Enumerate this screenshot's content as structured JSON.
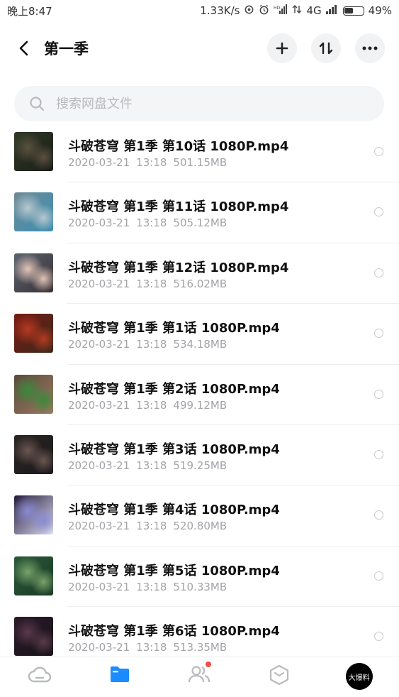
{
  "status_bar": {
    "time": "晚上8:47",
    "speed": "1.33K/s",
    "network": "4G",
    "battery": "49%",
    "battery_level": 0.49
  },
  "header": {
    "title": "第一季"
  },
  "search": {
    "placeholder": "搜索网盘文件"
  },
  "files": [
    {
      "name": "斗破苍穹 第1季 第10话 1080P.mp4",
      "date": "2020-03-21",
      "time": "13:18",
      "size": "501.15MB",
      "thumb_colors": [
        "#2e3a25",
        "#5a5040",
        "#1c1c18"
      ]
    },
    {
      "name": "斗破苍穹 第1季 第11话 1080P.mp4",
      "date": "2020-03-21",
      "time": "13:18",
      "size": "505.12MB",
      "thumb_colors": [
        "#6e8a96",
        "#b7c8cf",
        "#3c8fb2"
      ]
    },
    {
      "name": "斗破苍穹 第1季 第12话 1080P.mp4",
      "date": "2020-03-21",
      "time": "13:18",
      "size": "516.02MB",
      "thumb_colors": [
        "#5a6470",
        "#e2c4b6",
        "#3a3036"
      ]
    },
    {
      "name": "斗破苍穹 第1季 第1话 1080P.mp4",
      "date": "2020-03-21",
      "time": "13:18",
      "size": "534.18MB",
      "thumb_colors": [
        "#7a1a14",
        "#b53a22",
        "#3a2a1a"
      ]
    },
    {
      "name": "斗破苍穹 第1季 第2话 1080P.mp4",
      "date": "2020-03-21",
      "time": "13:18",
      "size": "499.12MB",
      "thumb_colors": [
        "#5a4a3a",
        "#3a8a3a",
        "#9a7a62"
      ]
    },
    {
      "name": "斗破苍穹 第1季 第3话 1080P.mp4",
      "date": "2020-03-21",
      "time": "13:18",
      "size": "519.25MB",
      "thumb_colors": [
        "#2a2422",
        "#6a5650",
        "#1a1a1c"
      ]
    },
    {
      "name": "斗破苍穹 第1季 第4话 1080P.mp4",
      "date": "2020-03-21",
      "time": "13:18",
      "size": "520.80MB",
      "thumb_colors": [
        "#241a3a",
        "#8a8ad2",
        "#dcdcf2"
      ]
    },
    {
      "name": "斗破苍穹 第1季 第5话 1080P.mp4",
      "date": "2020-03-21",
      "time": "13:18",
      "size": "510.33MB",
      "thumb_colors": [
        "#2a5a3a",
        "#7aa26a",
        "#1a3a24"
      ]
    },
    {
      "name": "斗破苍穹 第1季 第6话 1080P.mp4",
      "date": "2020-03-21",
      "time": "13:18",
      "size": "513.35MB",
      "thumb_colors": [
        "#2a1a2a",
        "#5a3a4a",
        "#181418"
      ]
    }
  ],
  "nav": {
    "items": [
      "cloud-icon",
      "folder-icon",
      "people-icon",
      "box-icon",
      "avatar"
    ],
    "active_color": "#1a8cff",
    "inactive_color": "#b8babd",
    "avatar_text": "大爆料"
  }
}
